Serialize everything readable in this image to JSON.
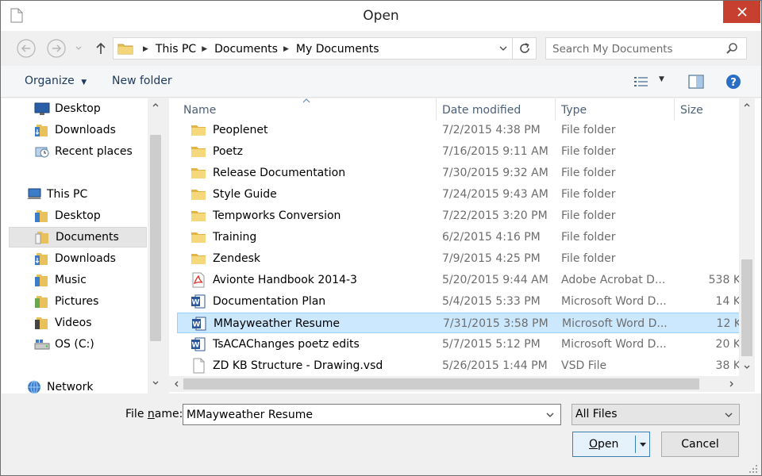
{
  "window": {
    "title": "Open"
  },
  "address": {
    "crumbs": [
      "This PC",
      "Documents",
      "My Documents"
    ]
  },
  "search": {
    "placeholder": "Search My Documents"
  },
  "toolbar": {
    "organize_label": "Organize",
    "new_folder_label": "New folder"
  },
  "nav": {
    "items": [
      {
        "label": "Desktop",
        "icon": "desktop-icon"
      },
      {
        "label": "Downloads",
        "icon": "downloads-folder-icon"
      },
      {
        "label": "Recent places",
        "icon": "recent-places-icon"
      },
      {
        "label": "This PC",
        "icon": "computer-icon"
      },
      {
        "label": "Desktop",
        "icon": "desktop-folder-icon"
      },
      {
        "label": "Documents",
        "icon": "documents-folder-icon",
        "selected": true
      },
      {
        "label": "Downloads",
        "icon": "downloads-folder-icon"
      },
      {
        "label": "Music",
        "icon": "music-folder-icon"
      },
      {
        "label": "Pictures",
        "icon": "pictures-folder-icon"
      },
      {
        "label": "Videos",
        "icon": "videos-folder-icon"
      },
      {
        "label": "OS (C:)",
        "icon": "drive-icon"
      },
      {
        "label": "Network",
        "icon": "network-icon"
      }
    ]
  },
  "columns": {
    "name": "Name",
    "date": "Date modified",
    "type": "Type",
    "size": "Size"
  },
  "files": [
    {
      "name": "Peoplenet",
      "date": "7/2/2015 4:38 PM",
      "type": "File folder",
      "size": "",
      "icon": "folder-icon"
    },
    {
      "name": "Poetz",
      "date": "7/16/2015 9:11 AM",
      "type": "File folder",
      "size": "",
      "icon": "folder-icon"
    },
    {
      "name": "Release Documentation",
      "date": "7/30/2015 9:32 AM",
      "type": "File folder",
      "size": "",
      "icon": "folder-icon"
    },
    {
      "name": "Style Guide",
      "date": "7/24/2015 9:43 AM",
      "type": "File folder",
      "size": "",
      "icon": "folder-icon"
    },
    {
      "name": "Tempworks Conversion",
      "date": "7/22/2015 3:20 PM",
      "type": "File folder",
      "size": "",
      "icon": "folder-icon"
    },
    {
      "name": "Training",
      "date": "6/2/2015 4:16 PM",
      "type": "File folder",
      "size": "",
      "icon": "folder-icon"
    },
    {
      "name": "Zendesk",
      "date": "7/9/2015 4:25 PM",
      "type": "File folder",
      "size": "",
      "icon": "folder-icon"
    },
    {
      "name": "Avionte Handbook 2014-3",
      "date": "5/20/2015 9:44 AM",
      "type": "Adobe Acrobat D...",
      "size": "538 K",
      "icon": "pdf-file-icon"
    },
    {
      "name": "Documentation Plan",
      "date": "5/4/2015 5:33 PM",
      "type": "Microsoft Word D...",
      "size": "14 K",
      "icon": "word-file-icon"
    },
    {
      "name": "MMayweather Resume",
      "date": "7/31/2015 3:58 PM",
      "type": "Microsoft Word D...",
      "size": "12 K",
      "icon": "word-file-icon",
      "selected": true
    },
    {
      "name": "TsACAChanges poetz edits",
      "date": "5/7/2015 5:12 PM",
      "type": "Microsoft Word D...",
      "size": "20 K",
      "icon": "word-file-icon"
    },
    {
      "name": "ZD KB Structure - Drawing.vsd",
      "date": "5/26/2015 1:44 PM",
      "type": "VSD File",
      "size": "38 K",
      "icon": "blank-file-icon"
    }
  ],
  "bottom": {
    "file_name_label": "File name:",
    "file_name_value": "MMayweather Resume",
    "filter_value": "All Files",
    "open_label": "Open",
    "cancel_label": "Cancel"
  },
  "colors": {
    "selection": "#cce8ff",
    "selection_border": "#99d1ff",
    "close": "#c7402f",
    "link_text": "#1e395b"
  }
}
